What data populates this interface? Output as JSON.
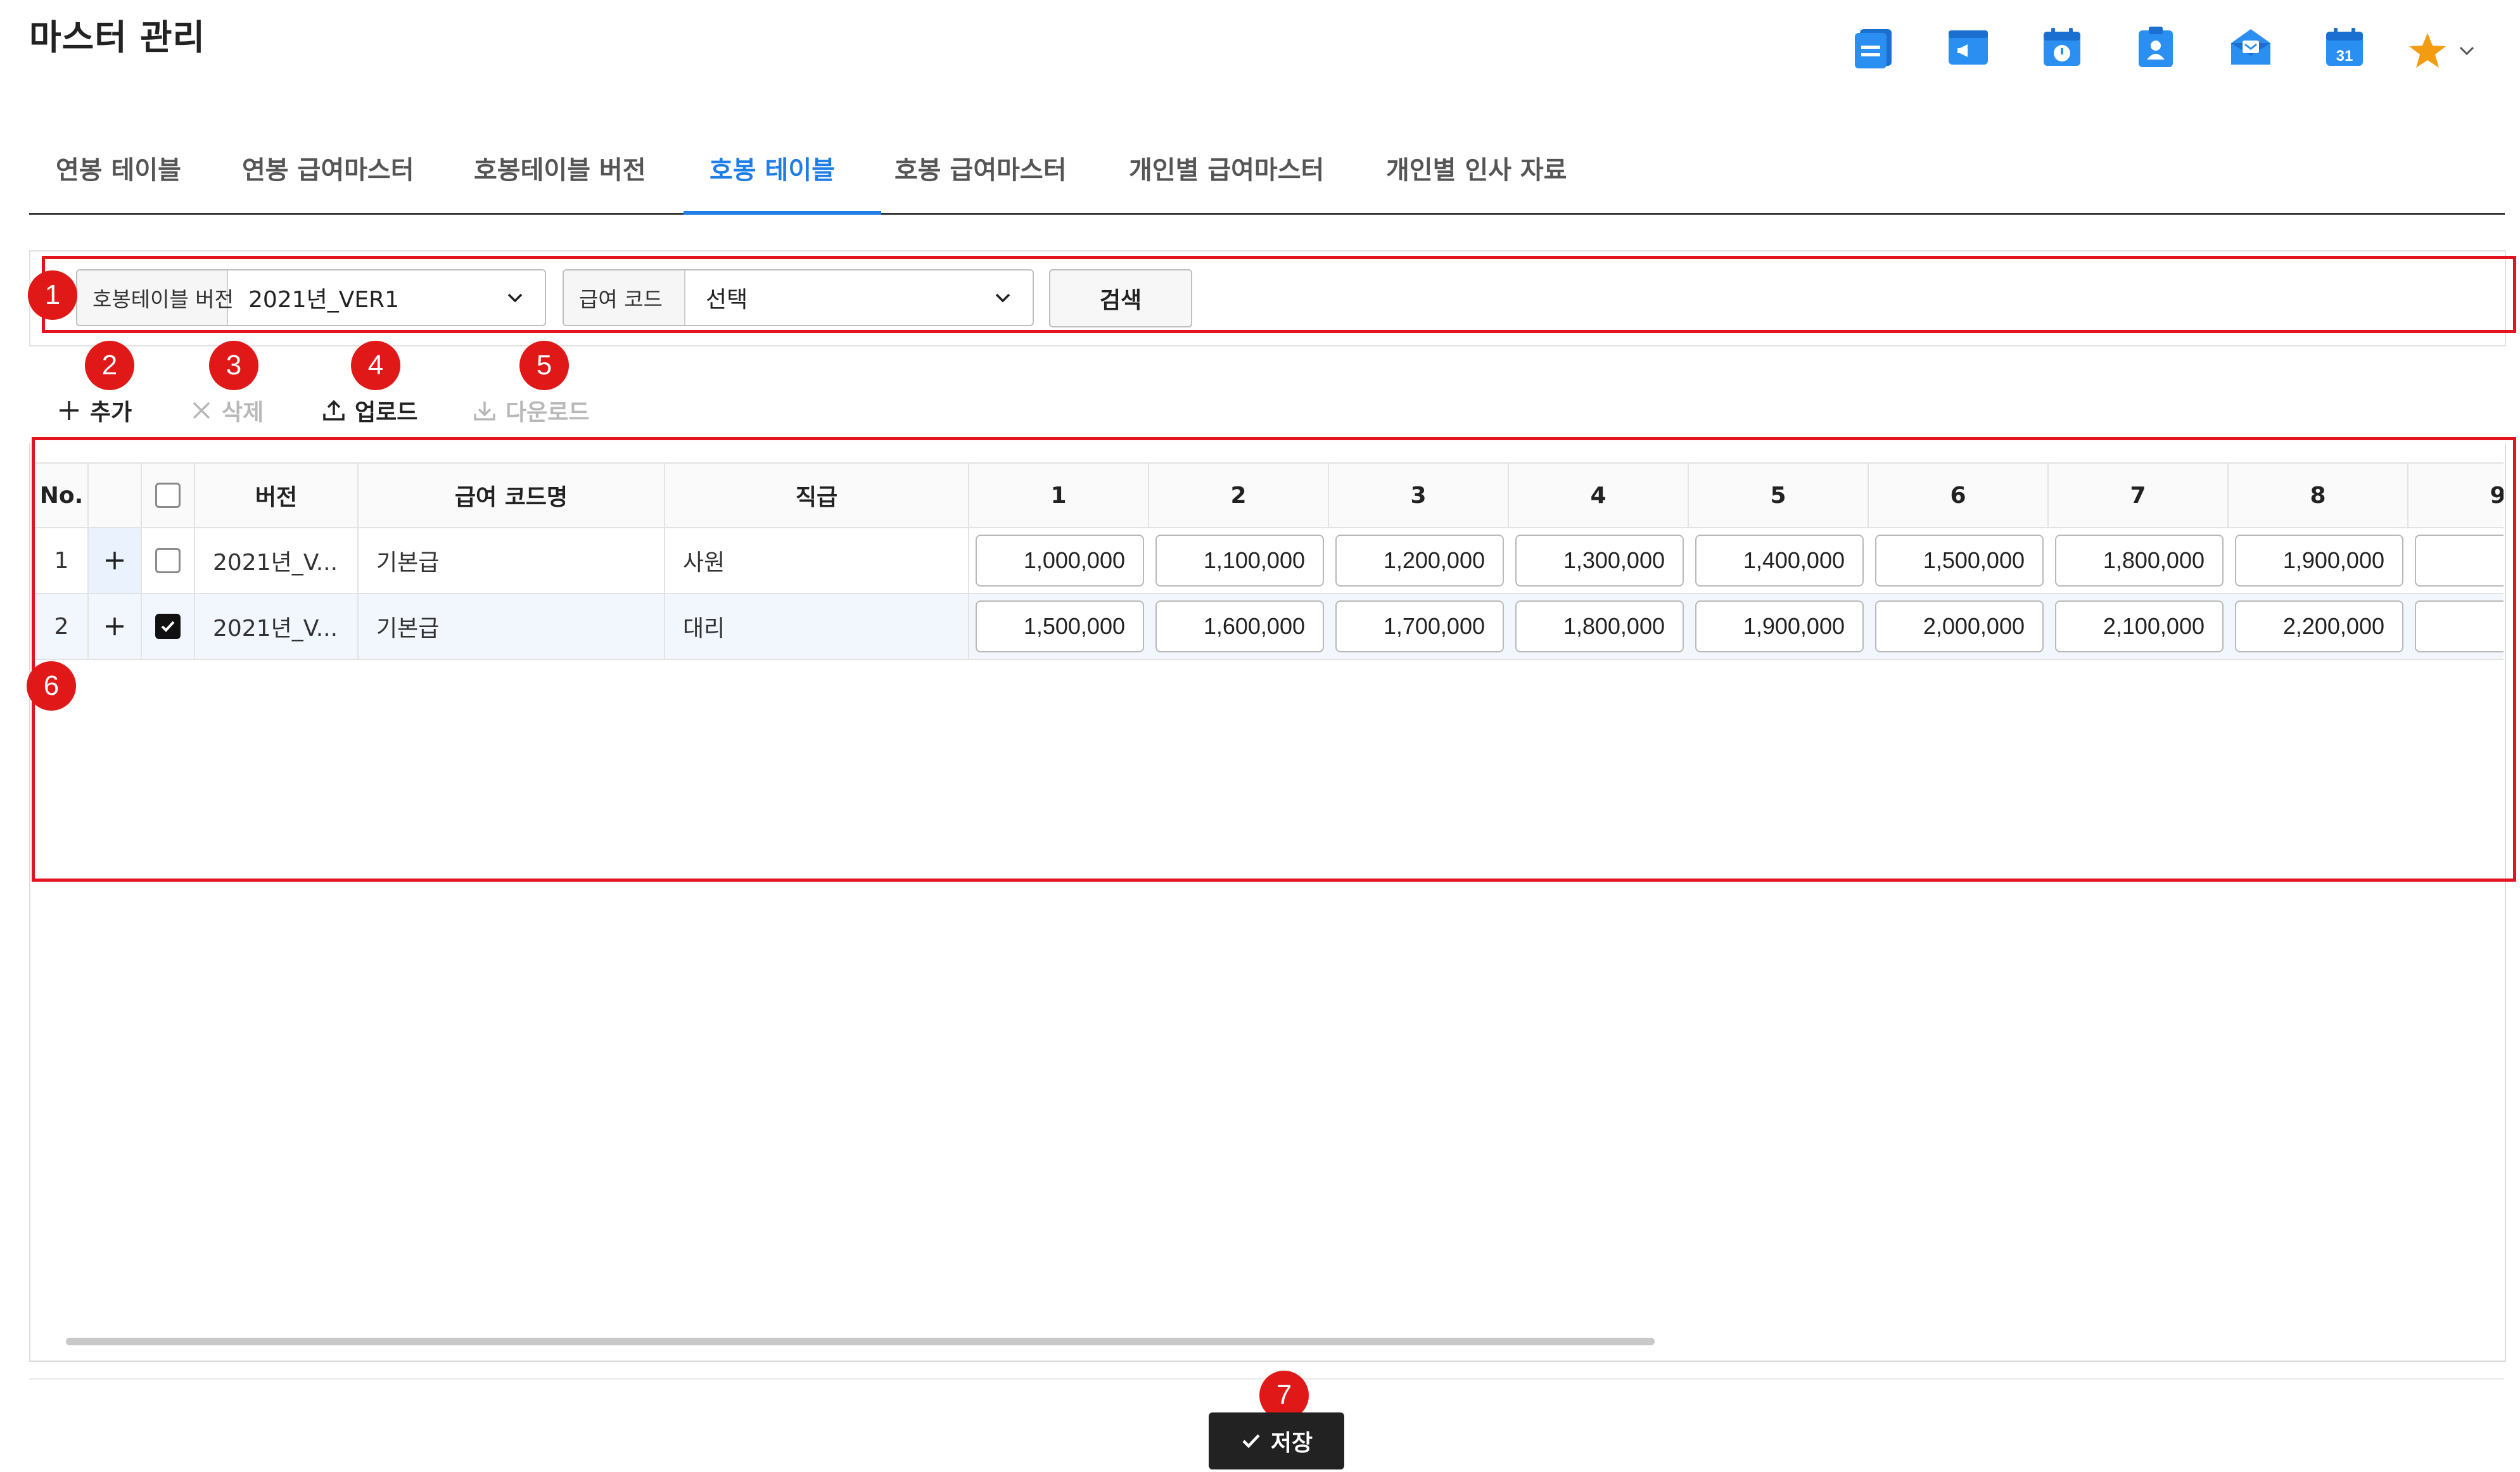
{
  "page_title": "마스터 관리",
  "header_icons": [
    "document-icon",
    "announcement-icon",
    "calendar-clock-icon",
    "contact-clipboard-icon",
    "mail-open-icon",
    "calendar-31-icon"
  ],
  "calendar_day": "31",
  "tabs": [
    {
      "label": "연봉 테이블",
      "active": false
    },
    {
      "label": "연봉 급여마스터",
      "active": false
    },
    {
      "label": "호봉테이블 버전",
      "active": false
    },
    {
      "label": "호봉 테이블",
      "active": true
    },
    {
      "label": "호봉 급여마스터",
      "active": false
    },
    {
      "label": "개인별 급여마스터",
      "active": false
    },
    {
      "label": "개인별 인사 자료",
      "active": false
    }
  ],
  "search": {
    "version_label": "호봉테이블 버전",
    "version_value": "2021년_VER1",
    "code_label": "급여 코드",
    "code_value": "선택",
    "search_button": "검색"
  },
  "toolbar": {
    "add": "추가",
    "delete": "삭제",
    "upload": "업로드",
    "download": "다운로드"
  },
  "markers": [
    "1",
    "2",
    "3",
    "4",
    "5",
    "6",
    "7"
  ],
  "grid": {
    "headers": {
      "no": "No.",
      "version": "버전",
      "code_name": "급여 코드명",
      "position": "직급",
      "steps": [
        "1",
        "2",
        "3",
        "4",
        "5",
        "6",
        "7",
        "8",
        "9"
      ]
    },
    "rows": [
      {
        "no": "1",
        "checked": false,
        "version": "2021년_V...",
        "code_name": "기본급",
        "position": "사원",
        "values": [
          "1,000,000",
          "1,100,000",
          "1,200,000",
          "1,300,000",
          "1,400,000",
          "1,500,000",
          "1,800,000",
          "1,900,000"
        ]
      },
      {
        "no": "2",
        "checked": true,
        "version": "2021년_V...",
        "code_name": "기본급",
        "position": "대리",
        "values": [
          "1,500,000",
          "1,600,000",
          "1,700,000",
          "1,800,000",
          "1,900,000",
          "2,000,000",
          "2,100,000",
          "2,200,000"
        ]
      }
    ]
  },
  "save_button": "저장",
  "colors": {
    "accent": "#1f7de6",
    "marker": "#e01818",
    "highlight_box": "#e3141f",
    "star": "#f39c12",
    "icon_blue": "#2a8ff0"
  }
}
